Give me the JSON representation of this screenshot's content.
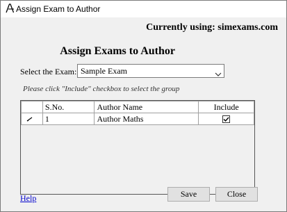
{
  "window": {
    "title": "Assign Exam to Author"
  },
  "header": {
    "currently_using": "Currently using: simexams.com",
    "heading": "Assign Exams to Author"
  },
  "exam_select": {
    "label": "Select the Exam:",
    "value": "Sample Exam"
  },
  "hint": "Please click \"Include\" checkbox to select the group",
  "grid": {
    "columns": [
      "",
      "S.No.",
      "Author Name",
      "Include"
    ],
    "rows": [
      {
        "sno": "1",
        "author": "Author Maths",
        "include": true
      }
    ]
  },
  "footer": {
    "help_label": "Help",
    "save_label": "Save",
    "close_label": "Close"
  }
}
